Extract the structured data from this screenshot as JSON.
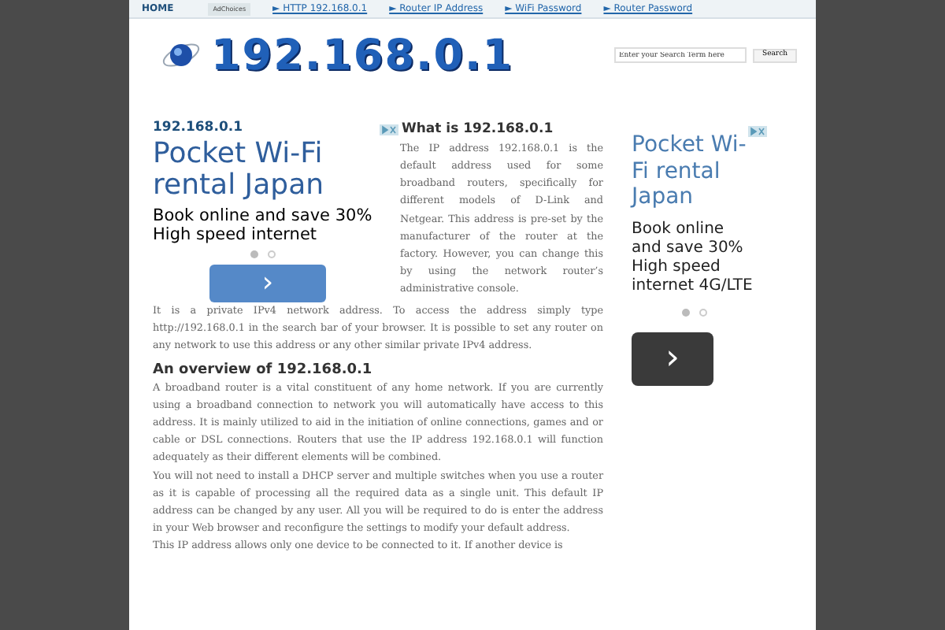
{
  "nav": {
    "items": [
      {
        "label": "HOME",
        "kind": "home"
      },
      {
        "label": "AdChoices",
        "kind": "adchoices"
      },
      {
        "label": "► HTTP 192.168.0.1",
        "kind": "link"
      },
      {
        "label": "► Router IP Address",
        "kind": "link"
      },
      {
        "label": "► WiFi Password",
        "kind": "link"
      },
      {
        "label": "► Router Password",
        "kind": "link"
      }
    ]
  },
  "header": {
    "logo_text": "192.168.0.1",
    "search": {
      "placeholder": "Enter your Search Term here",
      "button": "Search"
    }
  },
  "main": {
    "title": "192.168.0.1",
    "ad_left": {
      "headline": "Pocket Wi-Fi rental Japan",
      "body": "Book online and save 30% High speed internet",
      "next": "›",
      "dots": [
        {
          "selected": true
        },
        {
          "selected": false
        }
      ]
    },
    "intro_heading": "What is 192.168.0.1",
    "intro_text": "The IP address 192.168.0.1 is the default address used for some broadband routers, specifically for different models of D-Link and Netgear. This address is pre-set by the manufacturer of the router at the factory. However, you can change this by using the network router’s administrative console.",
    "paragraph": "It is a private IPv4 network address. To access the address simply type http://192.168.0.1 in the search bar of your browser. It is possible to set any router on any network to use this address or any other similar private IPv4 address.",
    "overview_heading": "An overview of 192.168.0.1",
    "overview_paragraphs": [
      "A broadband router is a vital constituent of any home network. If you are currently using a broadband connection to network you will automatically have access to this address. It is mainly utilized to aid in the initiation of online connections, games and or cable or DSL connections. Routers that use the IP address 192.168.0.1 will function adequately as their different elements will be combined.",
      "You will not need to install a DHCP server and multiple switches when you use a router as it is capable of processing all the required data as a single unit. This default IP address can be changed by any user. All you will be required to do is enter the address in your Web browser and reconfigure the settings to modify your default address.",
      "This IP address allows only one device to be connected to it. If another device is"
    ]
  },
  "sidebar": {
    "ad": {
      "headline": "Pocket Wi-Fi rental Japan",
      "body": "Book online and save 30% High speed internet 4G/LTE",
      "next": "›",
      "dots": [
        {
          "selected": true
        },
        {
          "selected": false
        }
      ]
    }
  }
}
